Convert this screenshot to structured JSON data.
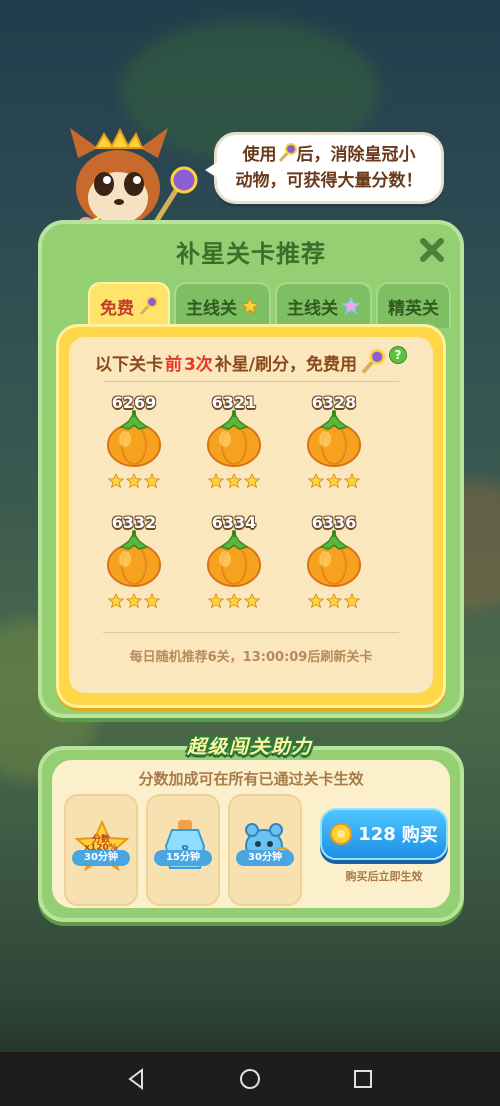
{
  "bubble": {
    "line1": "使用",
    "line1b": "后，消除皇冠小",
    "line2": "动物，可获得大量分数！"
  },
  "panel": {
    "title": "补星关卡推荐",
    "tabs": [
      {
        "label": "免费",
        "active": true
      },
      {
        "label": "主线关",
        "active": false
      },
      {
        "label": "主线关",
        "active": false
      },
      {
        "label": "精英关",
        "active": false
      }
    ],
    "notice": {
      "prefix": "以下关卡",
      "highlight_a": "前",
      "highlight_b": "3次",
      "suffix": "补星/刷分，免费用"
    },
    "levels": [
      {
        "number": "6269",
        "stars": 3
      },
      {
        "number": "6321",
        "stars": 3
      },
      {
        "number": "6328",
        "stars": 3
      },
      {
        "number": "6332",
        "stars": 3
      },
      {
        "number": "6334",
        "stars": 3
      },
      {
        "number": "6336",
        "stars": 3
      }
    ],
    "footer": "每日随机推荐6关，13:00:09后刷新关卡"
  },
  "boost": {
    "title": "超级闯关助力",
    "subtitle": "分数加成可在所有已通过关卡生效",
    "items": [
      {
        "tag_line1": "分数",
        "tag_line2": "x120%",
        "duration": "30分钟"
      },
      {
        "duration": "15分钟"
      },
      {
        "duration": "30分钟"
      }
    ],
    "buy": {
      "price": "128",
      "label": "购买",
      "note": "购买后立即生效"
    }
  },
  "colors": {
    "panel": "#94cf74",
    "frame": "#ffd84a",
    "buy": "#1d8fe6",
    "text_brown": "#8a4a1d",
    "red": "#e23a2a"
  }
}
